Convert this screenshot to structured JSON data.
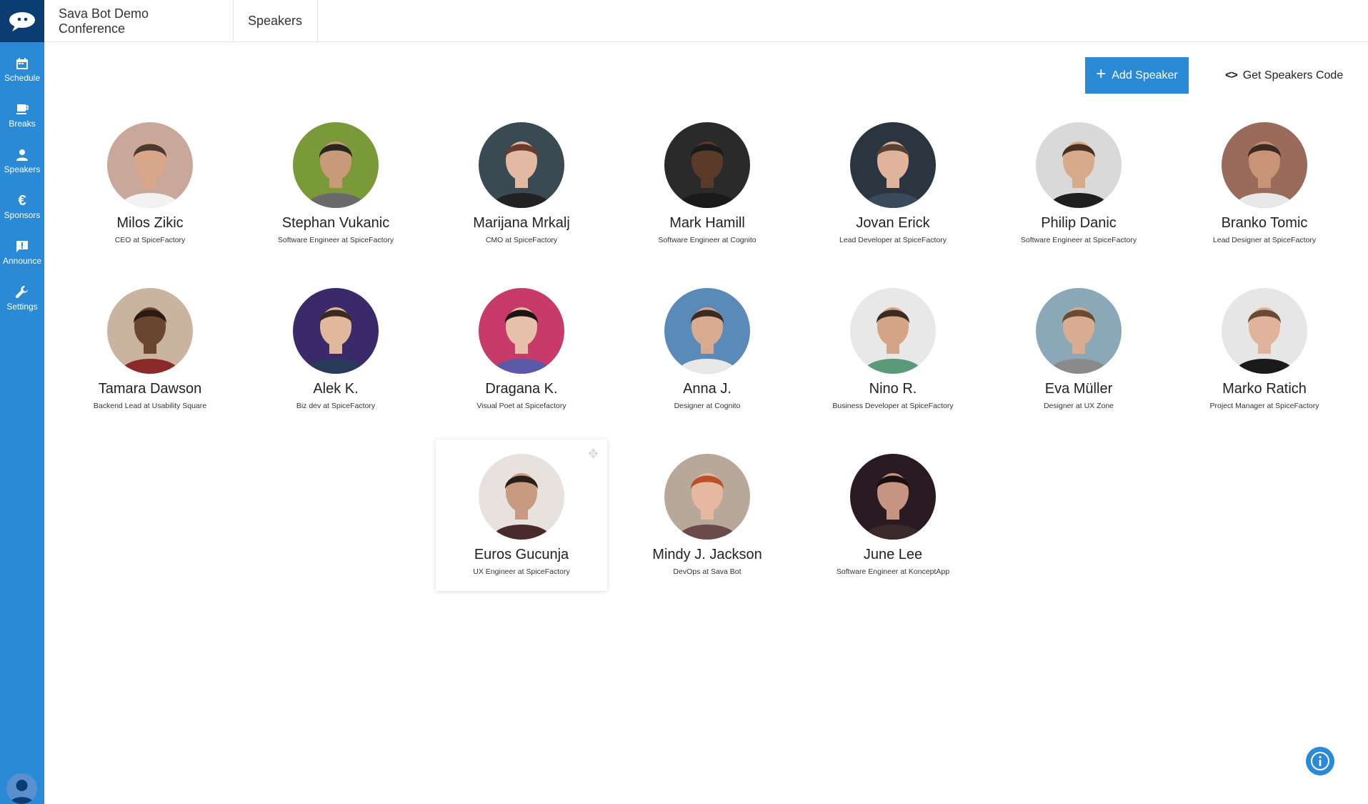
{
  "sidebar": {
    "items": [
      {
        "label": "Schedule",
        "icon": "calendar-icon"
      },
      {
        "label": "Breaks",
        "icon": "coffee-icon"
      },
      {
        "label": "Speakers",
        "icon": "person-icon"
      },
      {
        "label": "Sponsors",
        "icon": "euro-icon"
      },
      {
        "label": "Announce",
        "icon": "announce-icon"
      },
      {
        "label": "Settings",
        "icon": "wrench-icon"
      }
    ]
  },
  "header": {
    "breadcrumb": [
      "Sava Bot Demo Conference",
      "Speakers"
    ]
  },
  "actions": {
    "add_speaker": "Add Speaker",
    "get_code": "Get Speakers Code"
  },
  "speakers": [
    {
      "name": "Milos Zikic",
      "title": "CEO at SpiceFactory",
      "bg": "#c9a79a",
      "skin": "#d9a88a",
      "hair": "#4a3a30",
      "shirt": "#f2f2f2"
    },
    {
      "name": "Stephan Vukanic",
      "title": "Software Engineer at SpiceFactory",
      "bg": "#7a9a3a",
      "skin": "#c89a7a",
      "hair": "#2a2420",
      "shirt": "#6a6a6a"
    },
    {
      "name": "Marijana Mrkalj",
      "title": "CMO at SpiceFactory",
      "bg": "#3a4a52",
      "skin": "#e2b9a2",
      "hair": "#6a3a2a",
      "shirt": "#222222"
    },
    {
      "name": "Mark Hamill",
      "title": "Software Engineer at Cognito",
      "bg": "#2a2a2a",
      "skin": "#5a3a28",
      "hair": "#1a1a1a",
      "shirt": "#1a1a1a"
    },
    {
      "name": "Jovan Erick",
      "title": "Lead Developer at SpiceFactory",
      "bg": "#2a3540",
      "skin": "#e0b49a",
      "hair": "#5a4030",
      "shirt": "#3a4a5a"
    },
    {
      "name": "Philip Danic",
      "title": "Software Engineer at SpiceFactory",
      "bg": "#d9d9d9",
      "skin": "#d8aa8c",
      "hair": "#4a3020",
      "shirt": "#1f1f1f"
    },
    {
      "name": "Branko Tomic",
      "title": "Lead Designer at SpiceFactory",
      "bg": "#9a6a5a",
      "skin": "#c89478",
      "hair": "#3a2a20",
      "shirt": "#e8e8e8"
    },
    {
      "name": "Tamara Dawson",
      "title": "Backend Lead at Usability Square",
      "bg": "#c9b4a0",
      "skin": "#6a4530",
      "hair": "#2a1a12",
      "shirt": "#8a2a2a"
    },
    {
      "name": "Alek K.",
      "title": "Biz dev at SpiceFactory",
      "bg": "#3a2a6a",
      "skin": "#e2b89c",
      "hair": "#3a2a20",
      "shirt": "#2a3a5a"
    },
    {
      "name": "Dragana K.",
      "title": "Visual Poet at Spicefactory",
      "bg": "#c83a6a",
      "skin": "#e6c0a8",
      "hair": "#1a1412",
      "shirt": "#5a5aa8"
    },
    {
      "name": "Anna J.",
      "title": "Designer at Cognito",
      "bg": "#5a8ab8",
      "skin": "#d8aa90",
      "hair": "#3a2a22",
      "shirt": "#e8e8e8"
    },
    {
      "name": "Nino R.",
      "title": "Business Developer at SpiceFactory",
      "bg": "#e8e8e8",
      "skin": "#d4a486",
      "hair": "#3a2a20",
      "shirt": "#5a9a78"
    },
    {
      "name": "Eva Müller",
      "title": "Designer at UX Zone",
      "bg": "#8aa8b8",
      "skin": "#d8ac90",
      "hair": "#6a4a30",
      "shirt": "#8a8a8a"
    },
    {
      "name": "Marko Ratich",
      "title": "Project Manager at SpiceFactory",
      "bg": "#e6e6e6",
      "skin": "#e0b49a",
      "hair": "#6a4a32",
      "shirt": "#1a1a1a"
    },
    {
      "name": "Euros Gucunja",
      "title": "UX Engineer at SpiceFactory",
      "bg": "#e8e2de",
      "skin": "#c89a80",
      "hair": "#2a201a",
      "shirt": "#4a2a2a"
    },
    {
      "name": "Mindy J. Jackson",
      "title": "DevOps at Sava Bot",
      "bg": "#b8a89a",
      "skin": "#e6b8a0",
      "hair": "#b8502a",
      "shirt": "#6a4a4a"
    },
    {
      "name": "June Lee",
      "title": "Software Engineer at KonceptApp",
      "bg": "#2a1a22",
      "skin": "#c89482",
      "hair": "#1a0e10",
      "shirt": "#3a2a2a"
    }
  ],
  "colors": {
    "sidebar": "#2b8ad6",
    "logo_bg": "#0b3d72",
    "accent": "#2b8ad6"
  }
}
